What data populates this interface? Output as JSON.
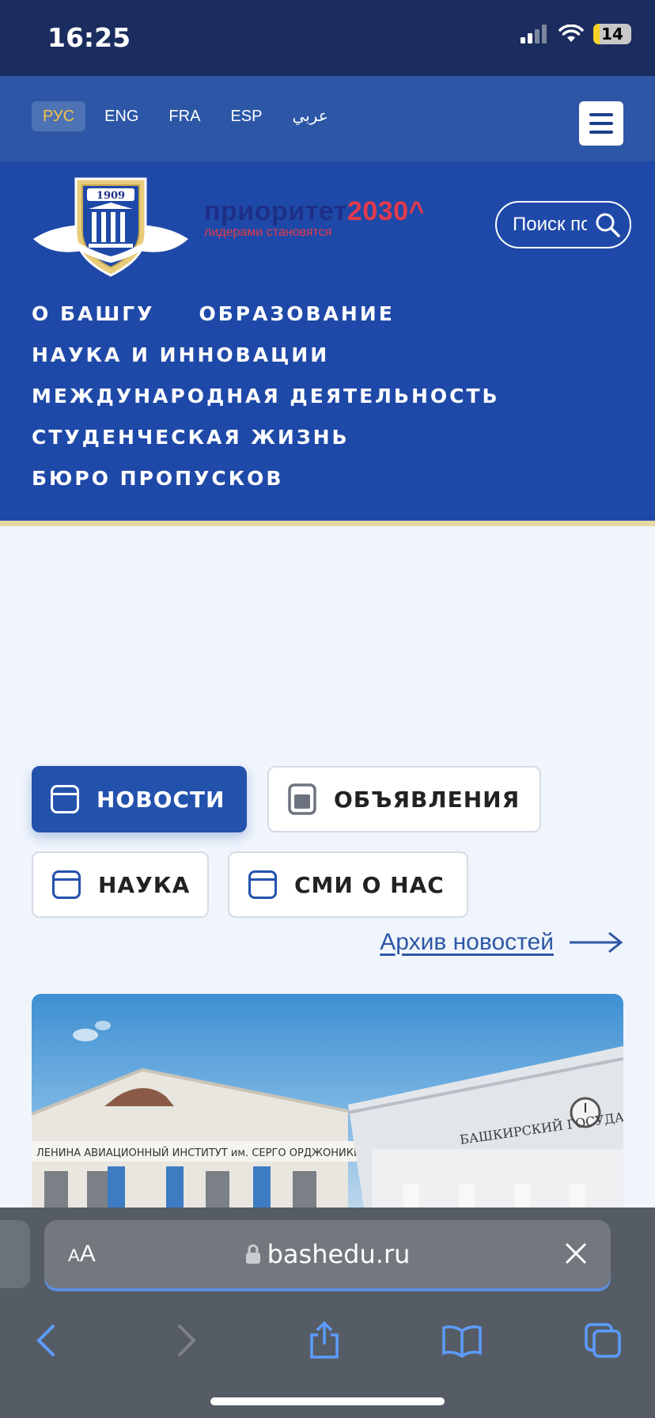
{
  "status_bar": {
    "time": "16:25",
    "battery": "14"
  },
  "languages": [
    {
      "label": "РУС",
      "active": true
    },
    {
      "label": "ENG",
      "active": false
    },
    {
      "label": "FRA",
      "active": false
    },
    {
      "label": "ESP",
      "active": false
    },
    {
      "label": "عربي",
      "active": false
    }
  ],
  "header": {
    "logo_year": "1909",
    "priority_title": "приоритет",
    "priority_year": "2030^",
    "priority_tagline": "лидерами становятся",
    "search_placeholder": "Поиск по сайту"
  },
  "nav": {
    "about": "О БАШГУ",
    "education": "ОБРАЗОВАНИЕ",
    "science": "НАУКА И ИННОВАЦИИ",
    "international": "МЕЖДУНАРОДНАЯ ДЕЯТЕЛЬНОСТЬ",
    "student_life": "СТУДЕНЧЕСКАЯ ЖИЗНЬ",
    "pass_office": "БЮРО ПРОПУСКОВ"
  },
  "tabs": {
    "news": "НОВОСТИ",
    "announcements": "ОБЪЯВЛЕНИЯ",
    "science": "НАУКА",
    "media": "СМИ О НАС"
  },
  "archive_link": "Архив новостей",
  "photo": {
    "sign_left": "ЛЕНИНА АВИАЦИОННЫЙ ИНСТИТУТ им. СЕРГО ОРДЖОНИКИДЗЕ",
    "sign_right": "БАШКИРСКИЙ ГОСУДАРСТВЕННЫЙ"
  },
  "browser": {
    "text_size_small": "A",
    "text_size_large": "A",
    "url": "bashedu.ru"
  },
  "colors": {
    "header_blue": "#1f49a8",
    "lang_bar": "#2d57a6",
    "status_bar": "#1b2d5e",
    "accent_gold": "#e7d6a4",
    "priority_red": "#e23a4a"
  }
}
